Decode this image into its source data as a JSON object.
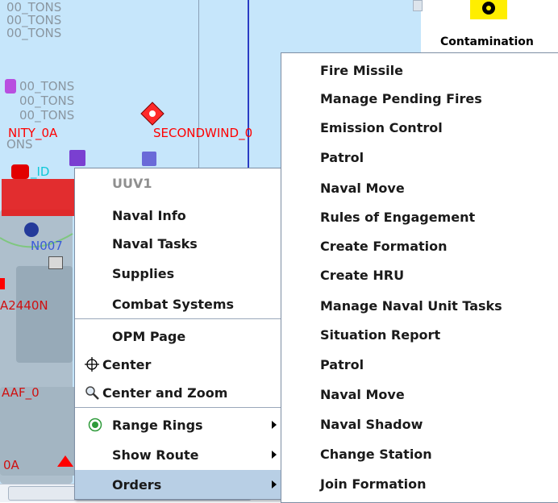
{
  "map": {
    "labels": {
      "tons_a": "00_TONS",
      "tons_b": "00_TONS",
      "tons_c": "00_TONS",
      "tons_d": "00_TONS",
      "tons_e": "00_TONS",
      "tons_f": "00_TONS",
      "tons_g": "ONS",
      "nity": "NITY_0A",
      "secondwind": "SECONDWIND_0",
      "id": "_ID",
      "n007": "N007",
      "a2440": "A2440N",
      "aaf": "AAF_0",
      "oa": "0A"
    }
  },
  "right_panel": {
    "contamination_label": "Contamination"
  },
  "context_menu": {
    "header": "UUV1",
    "items": [
      "Naval Info",
      "Naval Tasks",
      "Supplies",
      "Combat Systems"
    ],
    "items2": [
      "OPM Page",
      "Center",
      "Center and Zoom",
      "Range Rings",
      "Show Route",
      "Orders"
    ]
  },
  "submenu": {
    "items": [
      "Fire Missile",
      "Manage Pending Fires",
      "Emission Control",
      "Patrol",
      "Naval Move",
      "Rules of Engagement",
      "Create Formation",
      "Create HRU",
      "Manage Naval Unit Tasks",
      "Situation Report",
      "Patrol",
      "Naval Move",
      "Naval Shadow",
      "Change Station",
      "Join Formation"
    ]
  },
  "colors": {
    "map_water": "#c6e6fb",
    "land": "#aebfcc",
    "hostile_red": "#ff0000",
    "menu_selected": "#b8cfe5",
    "range_ring_green": "#2e9a3a",
    "contamination_yellow": "#ffee00"
  },
  "icons": [
    "crosshair-icon",
    "magnifier-icon",
    "radio-selected-icon",
    "submenu-arrow-icon",
    "contamination-hazard-icon"
  ]
}
